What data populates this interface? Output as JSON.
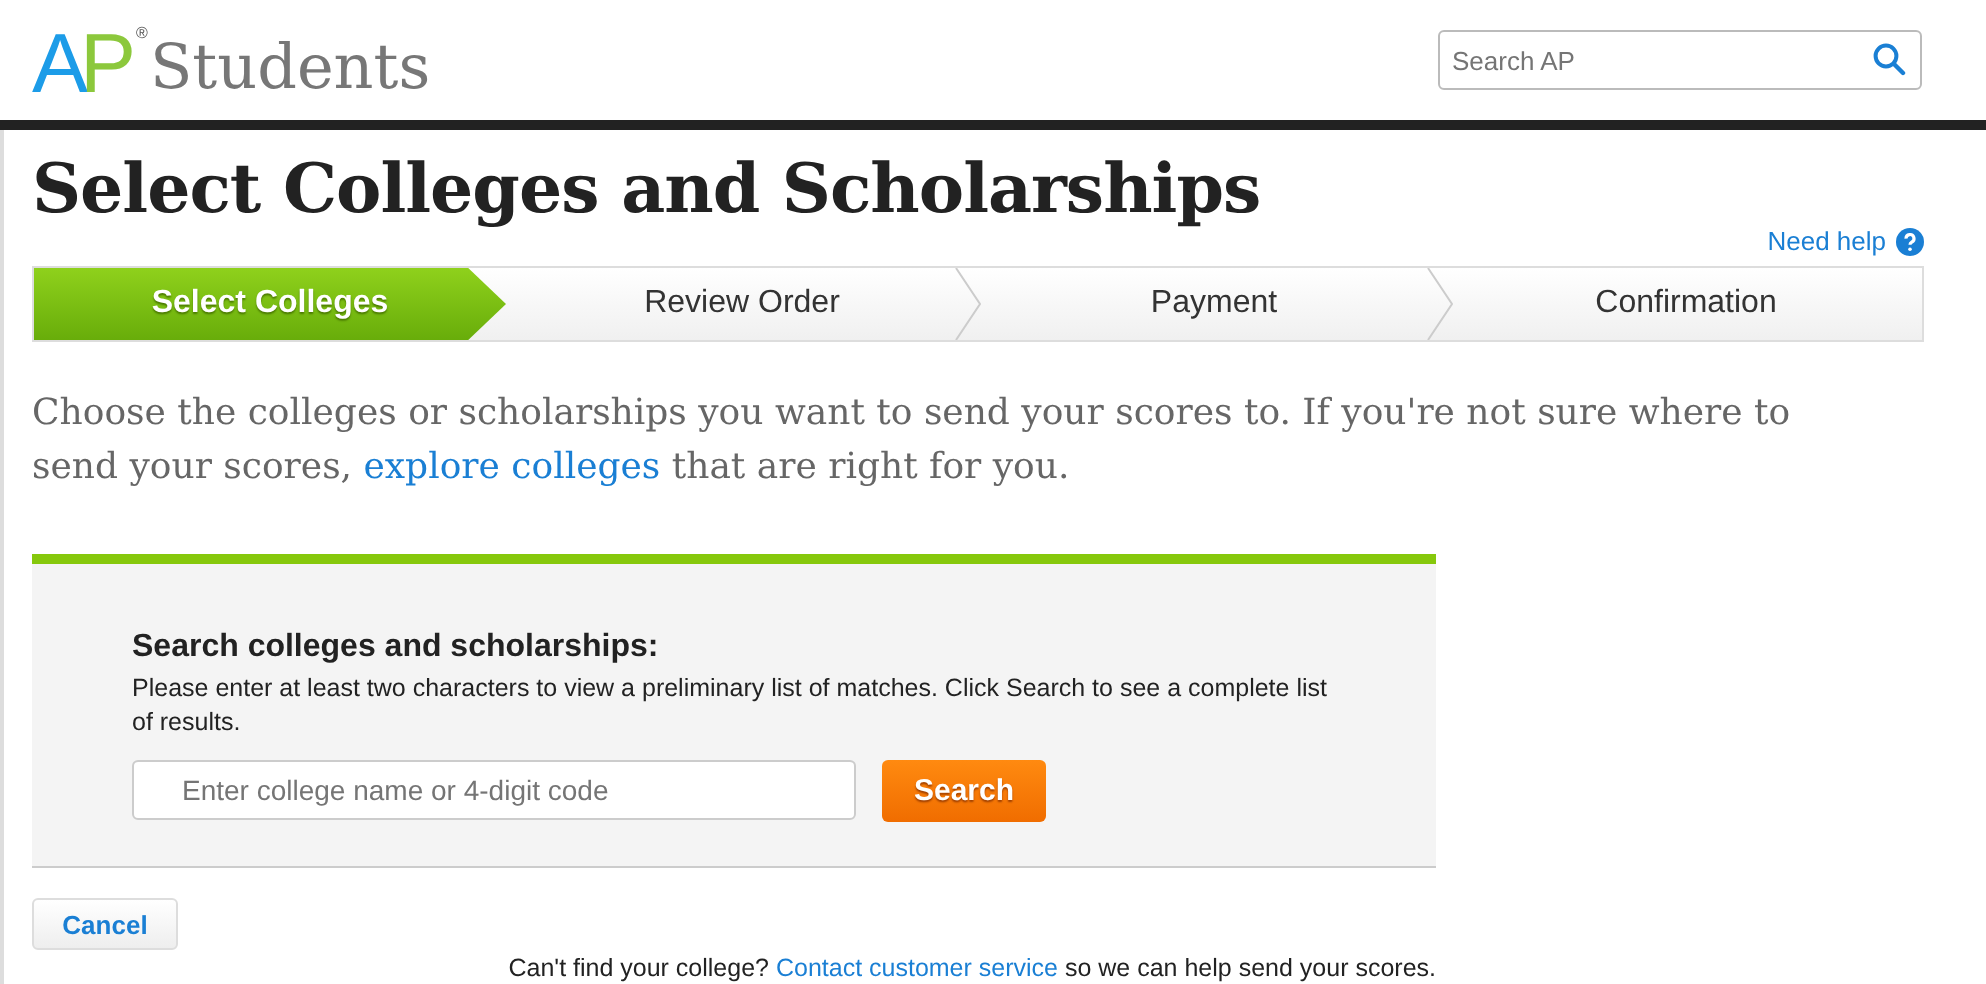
{
  "logo": {
    "letter_a": "A",
    "letter_p": "P",
    "registered": "®",
    "word": "Students"
  },
  "search": {
    "placeholder": "Search AP"
  },
  "title": "Select Colleges and Scholarships",
  "help_link": "Need help",
  "steps": [
    {
      "label": "Select Colleges",
      "selected": true
    },
    {
      "label": "Review Order",
      "selected": false
    },
    {
      "label": "Payment",
      "selected": false
    },
    {
      "label": "Confirmation",
      "selected": false
    }
  ],
  "intro": {
    "before": "Choose the colleges or scholarships you want to send your scores to. If you're not sure where to send your scores, ",
    "link": "explore colleges",
    "after": " that are right for you."
  },
  "panel": {
    "heading": "Search colleges and scholarships:",
    "description": "Please enter at least two characters to view a preliminary list of matches. Click Search to see a complete list of results.",
    "placeholder": "Enter college name or 4-digit code",
    "button": "Search"
  },
  "cancel": "Cancel",
  "footer": {
    "before": "Can't find your college? ",
    "link": "Contact customer service",
    "after": " so we can help send your scores."
  }
}
